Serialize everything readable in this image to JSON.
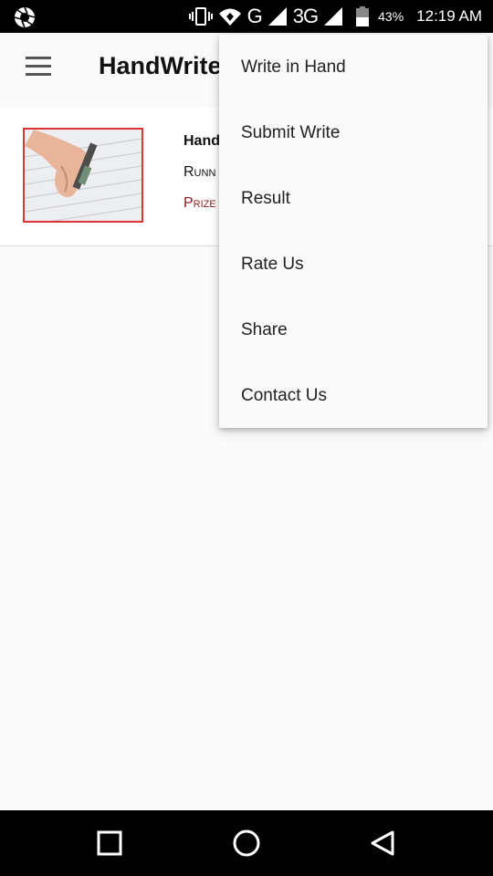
{
  "status_bar": {
    "network_g": "G",
    "network_3g": "3G",
    "battery_percent": "43%",
    "time": "12:19 AM",
    "icons": [
      "camera-aperture-icon",
      "vibrate-icon",
      "wifi-icon",
      "signal-icon",
      "battery-icon"
    ]
  },
  "app_bar": {
    "title": "HandWrite"
  },
  "card": {
    "title": "Hand",
    "subtitle": "Runn",
    "prize": "Prize"
  },
  "overflow_menu": {
    "items": [
      {
        "label": "Write in Hand"
      },
      {
        "label": "Submit Write"
      },
      {
        "label": "Result"
      },
      {
        "label": "Rate Us"
      },
      {
        "label": "Share"
      },
      {
        "label": "Contact Us"
      }
    ]
  },
  "nav_bar": {
    "buttons": [
      "recents-square-icon",
      "home-circle-icon",
      "back-triangle-icon"
    ]
  },
  "colors": {
    "background": "#fafafa",
    "status_bar": "#000000",
    "prize_text": "#8b1a1a",
    "thumb_border": "#dd3333"
  }
}
